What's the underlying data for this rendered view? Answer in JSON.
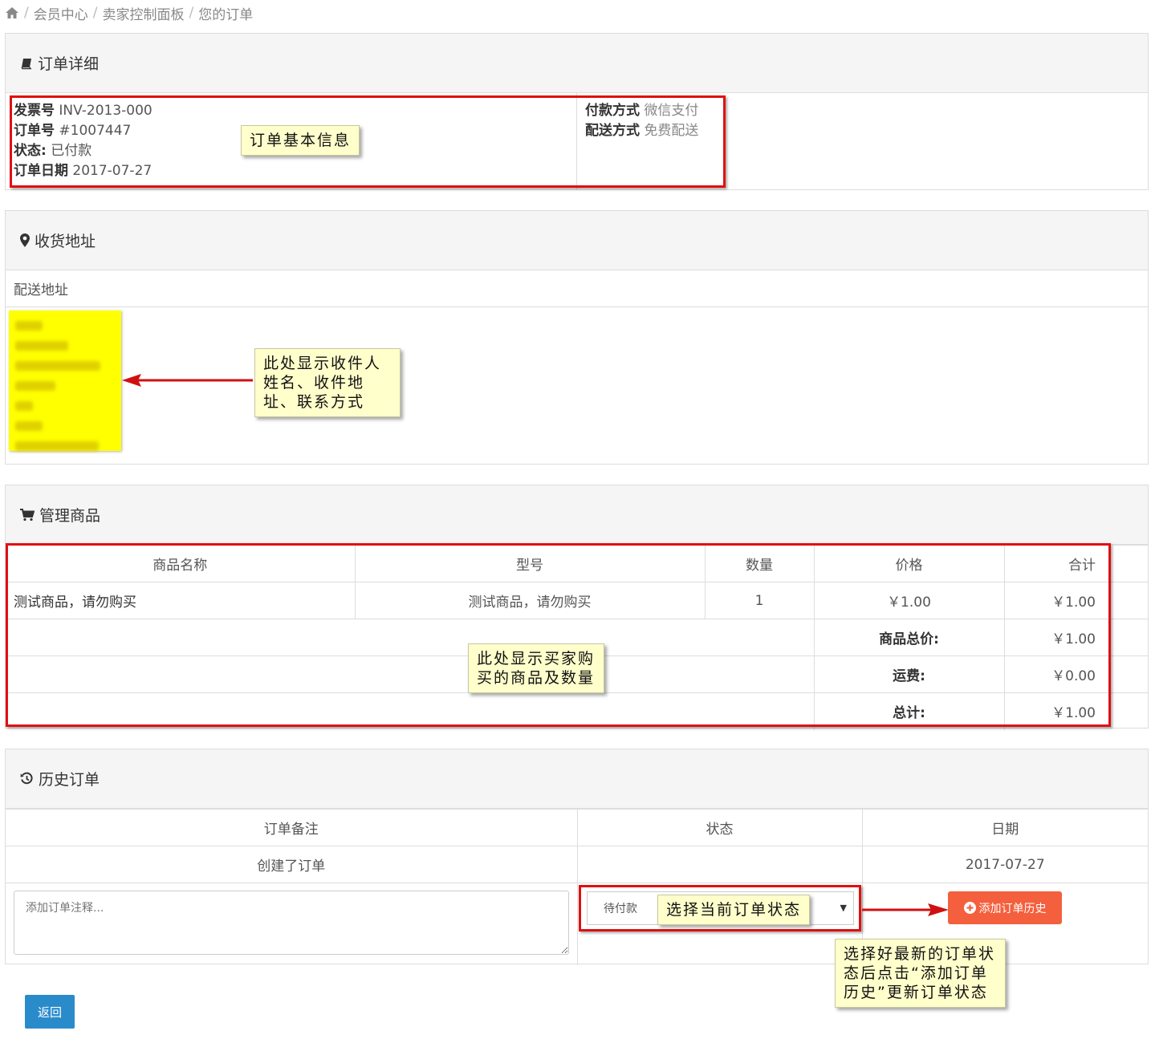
{
  "breadcrumb": {
    "items": [
      "会员中心",
      "卖家控制面板",
      "您的订单"
    ]
  },
  "order_details": {
    "title": "订单详细",
    "invoice_label": "发票号",
    "invoice_value": "INV-2013-000",
    "order_no_label": "订单号",
    "order_no_value": "#1007447",
    "status_label": "状态:",
    "status_value": "已付款",
    "date_label": "订单日期",
    "date_value": "2017-07-27",
    "payment_label": "付款方式",
    "payment_value": "微信支付",
    "shipping_label": "配送方式",
    "shipping_value": "免费配送"
  },
  "address": {
    "title": "收货地址",
    "subheading": "配送地址"
  },
  "products": {
    "title": "管理商品",
    "columns": [
      "商品名称",
      "型号",
      "数量",
      "价格",
      "合计"
    ],
    "rows": [
      {
        "name": "测试商品，请勿购买",
        "model": "测试商品，请勿购买",
        "qty": "1",
        "price": "￥1.00",
        "total": "￥1.00"
      }
    ],
    "summary": [
      {
        "label": "商品总价:",
        "value": "￥1.00"
      },
      {
        "label": "运费:",
        "value": "￥0.00"
      },
      {
        "label": "总计:",
        "value": "￥1.00"
      }
    ]
  },
  "history": {
    "title": "历史订单",
    "columns": [
      "订单备注",
      "状态",
      "日期"
    ],
    "rows": [
      {
        "note": "创建了订单",
        "status": "",
        "date": "2017-07-27"
      }
    ],
    "comment_placeholder": "添加订单注释...",
    "status_select_value": "待付款",
    "add_button_label": "添加订单历史"
  },
  "back_button_label": "返回",
  "annotations": {
    "order_info": "订单基本信息",
    "address": "此处显示收件人姓名、收件地址、联系方式",
    "products": "此处显示买家购买的商品及数量",
    "status_select": "选择当前订单状态",
    "add_history": "选择好最新的订单状态后点击“添加订单历史”更新订单状态"
  },
  "colors": {
    "annotation_border": "#e01010",
    "note_bg": "#ffffcc",
    "address_highlight": "#ffff00",
    "add_button": "#f4603e",
    "back_button": "#2a8bcb"
  }
}
